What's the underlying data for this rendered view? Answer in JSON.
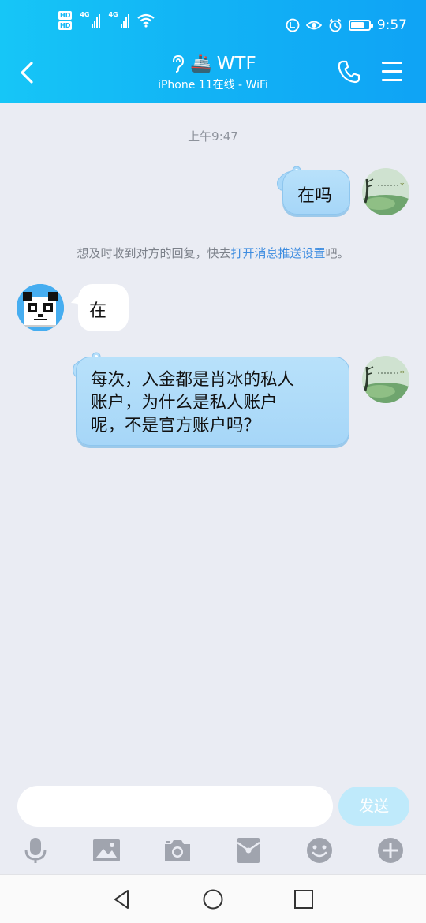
{
  "status_bar": {
    "hd1": "HD",
    "hd2": "HD",
    "net1": "4G",
    "net2": "4G",
    "time": "9:57"
  },
  "header": {
    "contact_name": "WTF",
    "contact_emoji": "🚢",
    "subtitle": "iPhone 11在线 - WiFi"
  },
  "chat": {
    "timestamp": "上午9:47",
    "messages": [
      {
        "side": "out",
        "text": "在吗"
      },
      {
        "side": "in",
        "text": "在"
      },
      {
        "side": "out",
        "lines": [
          "每次，入金都是肖冰的私人",
          "账户，为什么是私人账户",
          "呢，不是官方账户吗？"
        ]
      }
    ],
    "notice": {
      "prefix": "想及时收到对方的回复，快去",
      "link": "打开消息推送设置",
      "suffix": "吧。"
    }
  },
  "input": {
    "placeholder": "",
    "send_label": "发送"
  },
  "toolbar_icons": [
    "microphone-icon",
    "image-icon",
    "camera-icon",
    "red-packet-icon",
    "emoji-icon",
    "plus-icon"
  ],
  "colors": {
    "header_start": "#16C6F7",
    "header_end": "#0FA3F5",
    "bubble_out": "#A6D6F8",
    "background": "#EAECF3",
    "link": "#3D8CE0",
    "send_button": "#BFEAFB",
    "icons": "#A0A4AE"
  }
}
